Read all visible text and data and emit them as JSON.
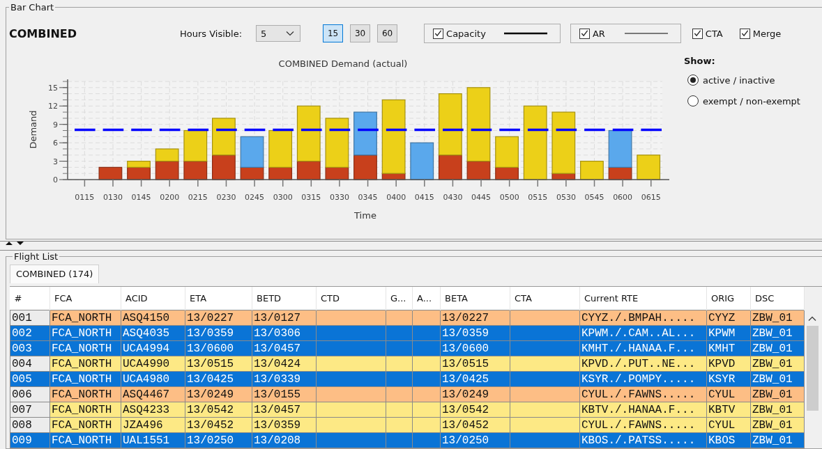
{
  "bar_chart_panel": {
    "title": "Bar Chart",
    "heading": "COMBINED",
    "hours_visible": {
      "label": "Hours Visible:",
      "value": "5"
    },
    "interval_buttons": [
      {
        "label": "15",
        "selected": true
      },
      {
        "label": "30",
        "selected": false
      },
      {
        "label": "60",
        "selected": false
      }
    ],
    "toggles": [
      {
        "label": "Capacity",
        "checked": true,
        "kind": "thick-line"
      },
      {
        "label": "AR",
        "checked": true,
        "kind": "thin-line"
      },
      {
        "label": "CTA",
        "checked": true,
        "kind": "plain"
      },
      {
        "label": "Merge",
        "checked": true,
        "kind": "plain"
      }
    ],
    "chart_data": {
      "type": "bar",
      "title": "COMBINED Demand (actual)",
      "xlabel": "Time",
      "ylabel": "Demand",
      "stacked": true,
      "orientation": "vertical",
      "categories": [
        "0115",
        "0130",
        "0145",
        "0200",
        "0215",
        "0230",
        "0245",
        "0300",
        "0315",
        "0330",
        "0345",
        "0400",
        "0415",
        "0430",
        "0445",
        "0500",
        "0515",
        "0530",
        "0545",
        "0600",
        "0615"
      ],
      "series": [
        {
          "color": "#c8401c",
          "values": [
            0,
            2,
            2,
            3,
            3,
            4,
            2,
            2,
            3,
            2,
            4,
            1,
            0,
            4,
            3,
            2,
            0,
            1,
            0,
            2,
            0
          ]
        },
        {
          "color": "#ecd018",
          "values": [
            0,
            0,
            1,
            2,
            5,
            6,
            0,
            6,
            9,
            8,
            0,
            12,
            0,
            10,
            12,
            5,
            12,
            10,
            3,
            0,
            4
          ]
        },
        {
          "color": "#5aa8ec",
          "values": [
            0,
            0,
            0,
            0,
            0,
            0,
            5,
            0,
            0,
            0,
            7,
            0,
            6,
            0,
            0,
            0,
            0,
            0,
            0,
            6,
            0
          ]
        }
      ],
      "ylim": [
        0,
        16
      ],
      "yticks": [
        0,
        3,
        6,
        9,
        12,
        15
      ],
      "grid": true,
      "ref_lines": [
        {
          "axis": "y",
          "value": 8.1,
          "color": "#0000ff"
        }
      ]
    },
    "show": {
      "label": "Show:",
      "options": [
        {
          "label": "active / inactive",
          "selected": true
        },
        {
          "label": "exempt / non-exempt",
          "selected": false
        }
      ]
    }
  },
  "flight_list_panel": {
    "title": "Flight List",
    "tabs": [
      {
        "label": "COMBINED (174)",
        "selected": true
      }
    ],
    "table": {
      "columns": [
        "#",
        "FCA",
        "ACID",
        "ETA",
        "BETD",
        "CTD",
        "G...",
        "A...",
        "BETA",
        "CTA",
        "Current RTE",
        "ORIG",
        "DSC"
      ],
      "rows": [
        {
          "selected": false,
          "color": "#fdbe85",
          "cells": [
            "001",
            "FCA_NORTH",
            "ASQ4150",
            "13/0227",
            "13/0127",
            null,
            null,
            null,
            "13/0227",
            null,
            "CYYZ./.BMPAH.....",
            "CYYZ",
            "ZBW_01"
          ]
        },
        {
          "selected": true,
          "cells": [
            "002",
            "FCA_NORTH",
            "ASQ4035",
            "13/0359",
            "13/0306",
            null,
            null,
            null,
            "13/0359",
            null,
            "KPWM./.CAM..AL...",
            "KPWM",
            "ZBW_01"
          ]
        },
        {
          "selected": true,
          "cells": [
            "003",
            "FCA_NORTH",
            "UCA4994",
            "13/0600",
            "13/0457",
            null,
            null,
            null,
            "13/0600",
            null,
            "KMHT./.HANAA.F...",
            "KMHT",
            "ZBW_01"
          ]
        },
        {
          "selected": false,
          "color": "#fde985",
          "cells": [
            "004",
            "FCA_NORTH",
            "UCA4990",
            "13/0515",
            "13/0424",
            null,
            null,
            null,
            "13/0515",
            null,
            "KPVD./.PUT..NE...",
            "KPVD",
            "ZBW_01"
          ]
        },
        {
          "selected": true,
          "cells": [
            "005",
            "FCA_NORTH",
            "UCA4980",
            "13/0425",
            "13/0339",
            null,
            null,
            null,
            "13/0425",
            null,
            "KSYR./.POMPY.....",
            "KSYR",
            "ZBW_01"
          ]
        },
        {
          "selected": false,
          "color": "#fdbe85",
          "cells": [
            "006",
            "FCA_NORTH",
            "ASQ4467",
            "13/0249",
            "13/0155",
            null,
            null,
            null,
            "13/0249",
            null,
            "CYUL./.FAWNS.....",
            "CYUL",
            "ZBW_01"
          ]
        },
        {
          "selected": false,
          "color": "#fde985",
          "cells": [
            "007",
            "FCA_NORTH",
            "ASQ4233",
            "13/0542",
            "13/0457",
            null,
            null,
            null,
            "13/0542",
            null,
            "KBTV./.HANAA.F...",
            "KBTV",
            "ZBW_01"
          ]
        },
        {
          "selected": false,
          "color": "#fde985",
          "cells": [
            "008",
            "FCA_NORTH",
            "JZA496",
            "13/0452",
            "13/0359",
            null,
            null,
            null,
            "13/0452",
            null,
            "CYUL./.FAWNS.....",
            "CYUL",
            "ZBW_01"
          ]
        },
        {
          "selected": true,
          "cells": [
            "009",
            "FCA_NORTH",
            "UAL1551",
            "13/0250",
            "13/0208",
            null,
            null,
            null,
            "13/0250",
            null,
            "KBOS./.PATSS.....",
            "KBOS",
            "ZBW_01"
          ]
        }
      ]
    }
  }
}
